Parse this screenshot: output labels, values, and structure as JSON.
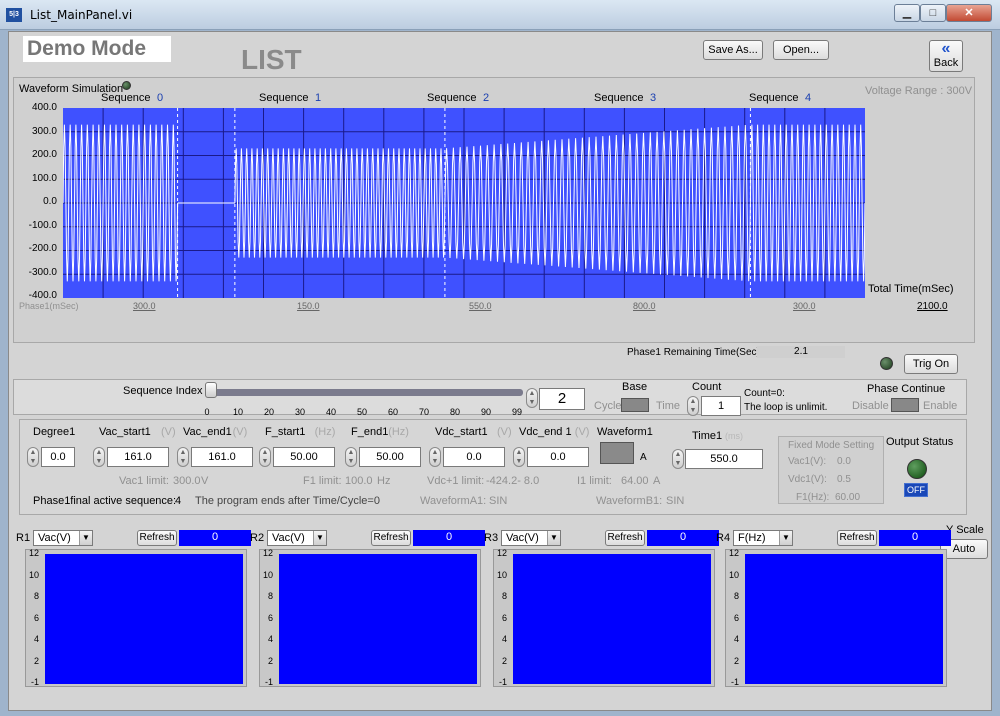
{
  "window": {
    "title": "List_MainPanel.vi",
    "icon_text": "5|3",
    "minimize": "▁",
    "maximize": "□",
    "close": "✕"
  },
  "header": {
    "mode": "Demo Mode",
    "page_title": "LIST",
    "save_as": "Save As...",
    "open": "Open...",
    "back": "Back",
    "back_icon": "«"
  },
  "waveform": {
    "label": "Waveform Simulation",
    "voltage_range": "Voltage Range : 300V",
    "sequences": [
      {
        "label": "Sequence",
        "num": "0"
      },
      {
        "label": "Sequence",
        "num": "1"
      },
      {
        "label": "Sequence",
        "num": "2"
      },
      {
        "label": "Sequence",
        "num": "3"
      },
      {
        "label": "Sequence",
        "num": "4"
      }
    ],
    "y_ticks": [
      "400.0",
      "300.0",
      "200.0",
      "100.0",
      "0.0",
      "-100.0",
      "-200.0",
      "-300.0",
      "-400.0"
    ],
    "total_time_label": "Total Time(mSec)",
    "phase_label": "Phase1(mSec)",
    "phase_values": [
      "300.0",
      "150.0",
      "550.0",
      "800.0",
      "300.0"
    ],
    "total_time_value": "2100.0",
    "plot_color": "#3f51ff",
    "chart_data": {
      "type": "line",
      "ylim": [
        -400,
        400
      ],
      "segments": [
        {
          "sequence": 0,
          "duration_ms": 300,
          "amplitude_v": 330,
          "cycles": 20
        },
        {
          "sequence": 1,
          "duration_ms": 150,
          "amplitude_v": 0,
          "cycles": 0
        },
        {
          "sequence": 2,
          "duration_ms": 550,
          "amplitude_v": 230,
          "cycles": 40
        },
        {
          "sequence": 3,
          "duration_ms": 800,
          "amplitude_v_start": 230,
          "amplitude_v_end": 330,
          "cycles": 45
        },
        {
          "sequence": 4,
          "duration_ms": 300,
          "amplitude_v": 330,
          "cycles": 20
        }
      ]
    }
  },
  "remaining": {
    "label": "Phase1 Remaining Time(Sec)",
    "value": "2.1"
  },
  "trig_on": "Trig On",
  "sequence_index": {
    "label": "Sequence Index",
    "ticks": [
      "0",
      "10",
      "20",
      "30",
      "40",
      "50",
      "60",
      "70",
      "80",
      "90",
      "99"
    ],
    "value": "2",
    "slider_fraction": 0.02
  },
  "base": {
    "label": "Base",
    "left": "Cycle",
    "right": "Time"
  },
  "count": {
    "label": "Count",
    "value": "1",
    "note1": "Count=0:",
    "note2": "The loop is unlimit."
  },
  "phase_continue": {
    "label": "Phase Continue",
    "left": "Disable",
    "right": "Enable"
  },
  "fields": [
    {
      "label": "Degree1",
      "unit": "",
      "value": "0.0"
    },
    {
      "label": "Vac_start1",
      "unit": "(V)",
      "value": "161.0"
    },
    {
      "label": "Vac_end1",
      "unit": "(V)",
      "value": "161.0"
    },
    {
      "label": "F_start1",
      "unit": "(Hz)",
      "value": "50.00"
    },
    {
      "label": "F_end1",
      "unit": "(Hz)",
      "value": "50.00"
    },
    {
      "label": "Vdc_start1",
      "unit": "(V)",
      "value": "0.0"
    },
    {
      "label": "Vdc_end 1",
      "unit": "(V)",
      "value": "0.0"
    }
  ],
  "waveform1": {
    "label": "Waveform1",
    "value": "A"
  },
  "time1": {
    "label": "Time1",
    "unit": "(ms)",
    "value": "550.0"
  },
  "limits": {
    "vac1": "Vac1 limit:",
    "vac1_val": "300.0",
    "vac1_unit": "V",
    "f1": "F1 limit:",
    "f1_val": "100.0",
    "f1_unit": "Hz",
    "vdc1": "Vdc+1 limit:",
    "vdc1_val": "-424.2- 8.0",
    "i1": "I1 limit:",
    "i1_val": "64.00",
    "i1_unit": "A"
  },
  "final_seq": {
    "label": "Phase1final active sequence:",
    "value": "4"
  },
  "program_note": "The program ends after Time/Cycle=0",
  "waveformA": {
    "label": "WaveformA1:",
    "value": "SIN"
  },
  "waveformB": {
    "label": "WaveformB1:",
    "value": "SIN"
  },
  "fixed_mode": {
    "title": "Fixed Mode Setting",
    "vac_label": "Vac1(V):",
    "vac": "0.0",
    "vdc_label": "Vdc1(V):",
    "vdc": "0.5",
    "f_label": "F1(Hz):",
    "f": "60.00"
  },
  "output_status": {
    "label": "Output Status",
    "state": "OFF"
  },
  "readings": [
    {
      "r": "R1",
      "select": "Vac(V)",
      "refresh": "Refresh",
      "value": "0"
    },
    {
      "r": "R2",
      "select": "Vac(V)",
      "refresh": "Refresh",
      "value": "0"
    },
    {
      "r": "R3",
      "select": "Vac(V)",
      "refresh": "Refresh",
      "value": "0"
    },
    {
      "r": "R4",
      "select": "F(Hz)",
      "refresh": "Refresh",
      "value": "0"
    }
  ],
  "graph_ticks": [
    "12",
    "10",
    "8",
    "6",
    "4",
    "2",
    "-1"
  ],
  "yscale": {
    "label": "Y Scale",
    "button": "Auto"
  }
}
